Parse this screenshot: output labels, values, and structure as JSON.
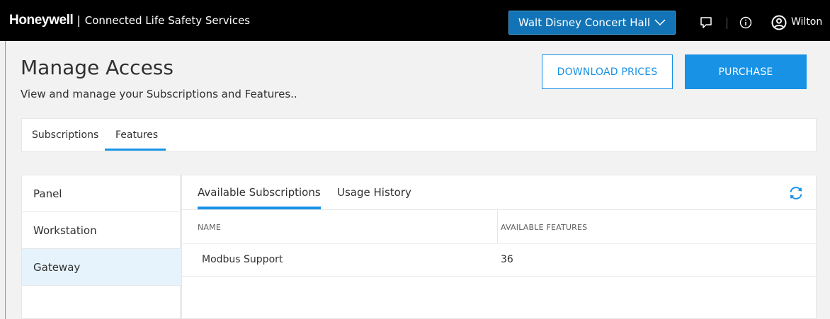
{
  "header": {
    "brand": "Honeywell",
    "separator": "|",
    "service_name": "Connected Life Safety Services",
    "site_selector": "Walt Disney Concert Hall",
    "user_name": "Wilton",
    "icons": [
      "chat-icon",
      "info-icon",
      "user-icon",
      "chevron-down-icon"
    ]
  },
  "page": {
    "title": "Manage Access",
    "subtitle": "View and manage your Subscriptions and Features.."
  },
  "actions": {
    "download_label": "DOWNLOAD PRICES",
    "purchase_label": "PURCHASE"
  },
  "tabs": [
    {
      "label": "Subscriptions",
      "active": false
    },
    {
      "label": "Features",
      "active": true
    }
  ],
  "left_nav": {
    "items": [
      {
        "label": "Panel",
        "active": false
      },
      {
        "label": "Workstation",
        "active": false
      },
      {
        "label": "Gateway",
        "active": true
      }
    ]
  },
  "panel": {
    "subtabs": [
      {
        "label": "Available Subscriptions",
        "active": true
      },
      {
        "label": "Usage History",
        "active": false
      }
    ],
    "table": {
      "columns": [
        "NAME",
        "AVAILABLE FEATURES"
      ],
      "rows": [
        {
          "name": "Modbus Support",
          "available_features": "36"
        }
      ]
    }
  },
  "colors": {
    "accent": "#1792e5",
    "header_bg": "#000000",
    "selector_bg": "#1274b7",
    "active_nav_bg": "#e6f3fc",
    "page_bg": "#f0f0f0"
  }
}
